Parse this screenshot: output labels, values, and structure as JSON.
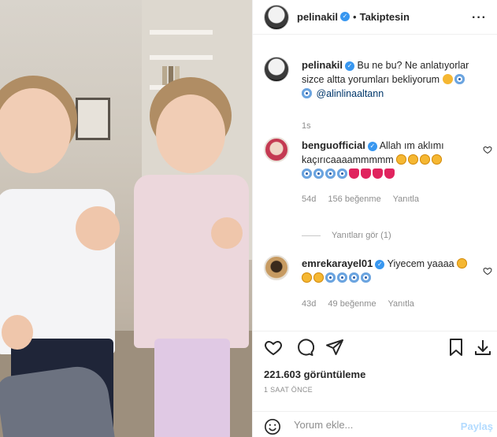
{
  "post": {
    "username": "pelinakil",
    "follow_status": "Takiptesin",
    "separator": "•",
    "more_icon": "more-horizontal-icon",
    "caption": {
      "text": "Bu ne bu? Ne anlatıyorlar sizce altta yorumları bekliyorum",
      "mention": "@alinlinaaltann",
      "time": "1s"
    }
  },
  "comments": [
    {
      "username": "benguofficial",
      "text": "Allah ım aklımı kaçırıcaaaammmmm",
      "time": "54d",
      "likes": "156 beğenme",
      "reply": "Yanıtla",
      "view_replies": "Yanıtları gör (1)"
    },
    {
      "username": "emrekarayel01",
      "text": "Yiyecem yaaaa",
      "time": "43d",
      "likes": "49 beğenme",
      "reply": "Yanıtla"
    }
  ],
  "stats": {
    "views": "221.603 görüntüleme",
    "posted_ago": "1 SAAT ÖNCE"
  },
  "comment_box": {
    "placeholder": "Yorum ekle...",
    "post_label": "Paylaş"
  },
  "colors": {
    "verified": "#3897f0",
    "text": "#262626",
    "muted": "#8e8e8e",
    "post_disabled": "#b3dbff"
  }
}
